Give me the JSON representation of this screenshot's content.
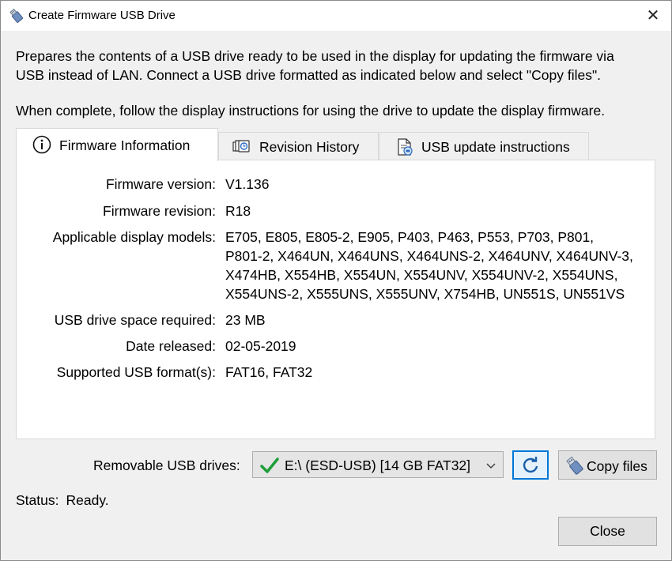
{
  "window": {
    "title": "Create Firmware USB Drive",
    "close_glyph": "✕"
  },
  "intro": {
    "line1": "Prepares the contents of a USB drive ready to be used in the display for updating the firmware via",
    "line2": "USB instead of LAN. Connect a USB drive formatted as indicated below and select \"Copy files\".",
    "line3": "When complete, follow the display instructions for using the drive to update the display firmware."
  },
  "tabs": [
    {
      "label": "Firmware Information",
      "icon": "info-icon",
      "active": true
    },
    {
      "label": "Revision History",
      "icon": "revision-history-icon",
      "active": false
    },
    {
      "label": "USB update instructions",
      "icon": "document-icon",
      "active": false
    }
  ],
  "firmware_info": {
    "version_label": "Firmware version:",
    "version": "V1.136",
    "revision_label": "Firmware revision:",
    "revision": "R18",
    "models_label": "Applicable display models:",
    "models_lines": [
      "E705, E805, E805-2, E905, P403, P463, P553, P703, P801,",
      "P801-2, X464UN, X464UNS, X464UNS-2, X464UNV, X464UNV-3,",
      "X474HB, X554HB, X554UN, X554UNV, X554UNV-2, X554UNS,",
      "X554UNS-2, X555UNS, X555UNV, X754HB, UN551S, UN551VS"
    ],
    "space_label": "USB drive space required:",
    "space": "23 MB",
    "date_label": "Date released:",
    "date": "02-05-2019",
    "format_label": "Supported USB format(s):",
    "format": "FAT16, FAT32"
  },
  "usb": {
    "label": "Removable USB drives:",
    "selected_drive": "E:\\ (ESD-USB) [14 GB FAT32]",
    "copy_label": "Copy files"
  },
  "status": {
    "label": "Status:",
    "value": "Ready."
  },
  "footer": {
    "close_label": "Close"
  },
  "colors": {
    "accent": "#0078d7",
    "check": "#1e9e3a"
  }
}
